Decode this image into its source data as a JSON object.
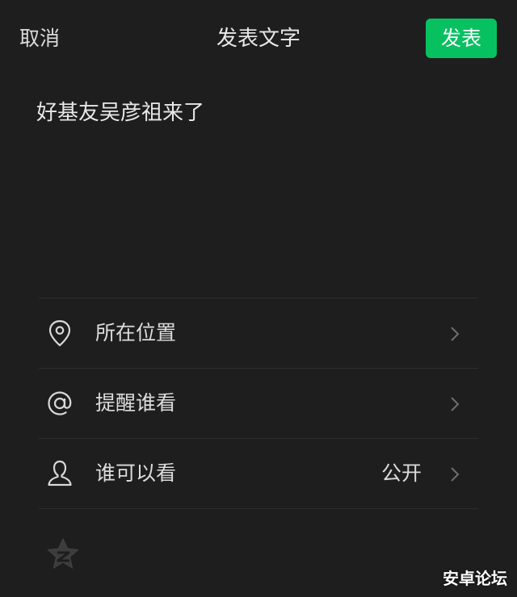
{
  "header": {
    "cancel_label": "取消",
    "title": "发表文字",
    "publish_label": "发表"
  },
  "post": {
    "text": "好基友吴彦祖来了"
  },
  "options": [
    {
      "label": "所在位置",
      "value": "",
      "icon": "location-pin-icon"
    },
    {
      "label": "提醒谁看",
      "value": "",
      "icon": "at-sign-icon"
    },
    {
      "label": "谁可以看",
      "value": "公开",
      "icon": "person-icon"
    }
  ],
  "share_icon": "qzone-star-icon",
  "watermark": "安卓论坛",
  "colors": {
    "background": "#1e1e1e",
    "accent": "#07c160",
    "divider": "#2d2d2d"
  }
}
